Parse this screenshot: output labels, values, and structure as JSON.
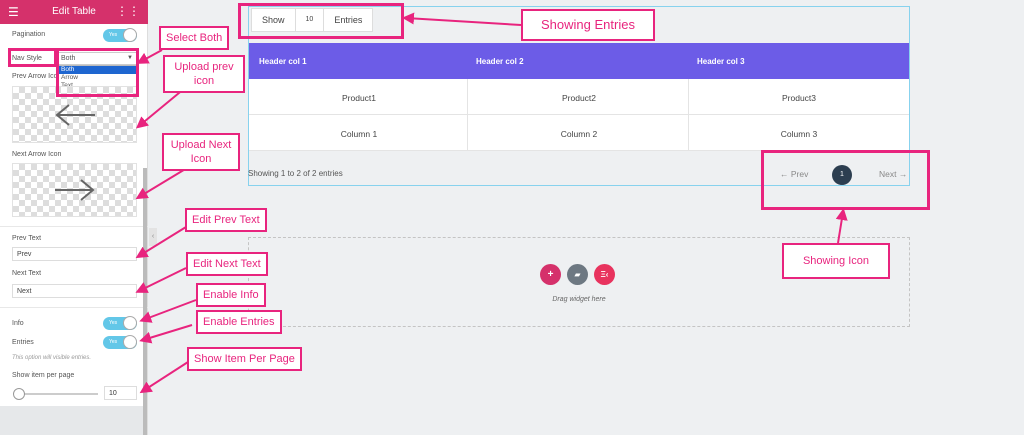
{
  "sidebar": {
    "header_title": "Edit Table",
    "pagination_label": "Pagination",
    "toggle_text": "Yes",
    "nav_style_label": "Nav Style",
    "nav_style_value": "Both",
    "nav_style_options": [
      "Both",
      "Arrow",
      "Text"
    ],
    "prev_arrow_label": "Prev Arrow Icon",
    "next_arrow_label": "Next Arrow Icon",
    "prev_text_label": "Prev Text",
    "prev_text_value": "Prev",
    "next_text_label": "Next Text",
    "next_text_value": "Next",
    "info_label": "Info",
    "entries_label": "Entries",
    "entries_hint": "This option will visible entries.",
    "per_page_label": "Show item per page",
    "per_page_value": "10"
  },
  "table": {
    "entries_show": "Show",
    "entries_count": "10",
    "entries_label": "Entries",
    "headers": [
      "Header col 1",
      "Header col 2",
      "Header col 3"
    ],
    "rows": [
      [
        "Product1",
        "Product2",
        "Product3"
      ],
      [
        "Column 1",
        "Column 2",
        "Column 3"
      ]
    ],
    "info_text": "Showing 1 to 2 of 2 entries",
    "prev_label": "← Prev",
    "page_number": "1",
    "next_label": "Next →"
  },
  "drop_zone": {
    "text": "Drag widget here",
    "add_symbol": "+",
    "folder_symbol": "▰",
    "ek_symbol": "Ξ‹"
  },
  "annotations": {
    "select_both": "Select Both",
    "upload_prev": "Upload prev icon",
    "upload_next": "Upload Next Icon",
    "edit_prev": "Edit Prev Text",
    "edit_next": "Edit Next Text",
    "enable_info": "Enable Info",
    "enable_entries": "Enable Entries",
    "show_per_page": "Show Item Per Page",
    "showing_entries": "Showing Entries",
    "showing_icon": "Showing Icon"
  },
  "colors": {
    "sidebar_header": "#d5316b",
    "table_header": "#6c5ce7",
    "annotation": "#e8247e",
    "toggle_on": "#63c7e8",
    "select_highlight": "#1e66d0"
  }
}
